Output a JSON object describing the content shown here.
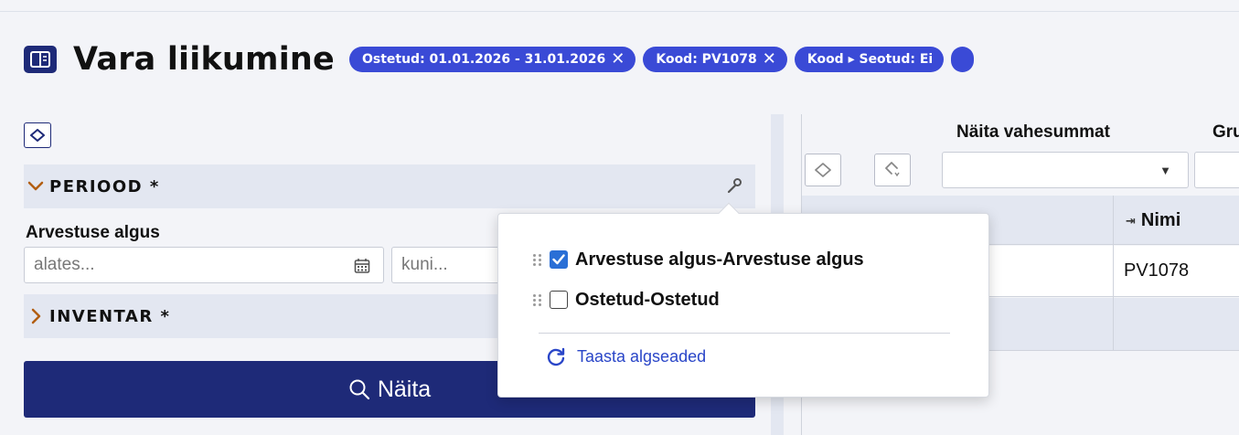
{
  "header": {
    "title": "Vara liikumine",
    "filters": [
      {
        "label": "Ostetud: 01.01.2026 - 31.01.2026",
        "removable": true
      },
      {
        "label": "Kood: PV1078",
        "removable": true
      },
      {
        "label": "Kood ▸ Seotud: Ei",
        "removable": false
      }
    ],
    "remove_symbol": "✕"
  },
  "filters_panel": {
    "sections": [
      {
        "label": "PERIOOD *",
        "expanded": true
      },
      {
        "label": "INVENTAR *",
        "expanded": false
      }
    ],
    "field_label": "Arvestuse algus",
    "from_placeholder": "alates...",
    "to_placeholder": "kuni...",
    "show_button": "Näita"
  },
  "report": {
    "subtotals_label": "Näita vahesummat",
    "group_label_partial": "Gru",
    "columns": [
      "Nimi"
    ],
    "rows": [
      {
        "name": "PV1078"
      }
    ]
  },
  "popup": {
    "items": [
      {
        "label": "Arvestuse algus-Arvestuse algus",
        "checked": true
      },
      {
        "label": "Ostetud-Ostetud",
        "checked": false
      }
    ],
    "reset_label": "Taasta algseaded"
  },
  "colors": {
    "brand_navy": "#1e2a78",
    "chip_blue": "#3a4ad6",
    "checkbox_blue": "#2a6fd6",
    "panel_bg": "#e3e7f1",
    "link_blue": "#2a46c8",
    "chevron_orange": "#b25e12"
  },
  "icons": [
    "book-icon",
    "close-icon",
    "collapse-icon",
    "chevron-down-icon",
    "chevron-right-icon",
    "wrench-icon",
    "calendar-icon",
    "search-icon",
    "pin-icon",
    "drag-handle-icon",
    "checkbox-checked-icon",
    "checkbox-unchecked-icon",
    "reset-icon",
    "caret-down-icon"
  ]
}
